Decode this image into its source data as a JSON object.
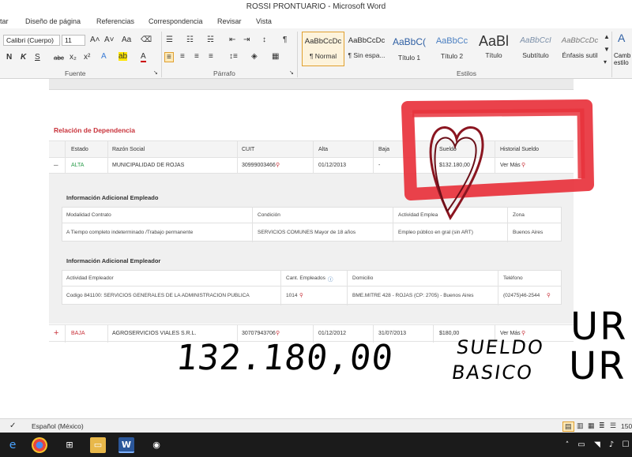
{
  "window": {
    "title": "ROSSI PRONTUARIO  -  Microsoft Word"
  },
  "ribbon_tabs": [
    "tar",
    "Diseño de página",
    "Referencias",
    "Correspondencia",
    "Revisar",
    "Vista"
  ],
  "ribbon": {
    "font_name": "Calibri (Cuerpo)",
    "font_size": "11",
    "group_font": "Fuente",
    "group_paragraph": "Párrafo",
    "group_styles": "Estilos",
    "styles": [
      {
        "sample": "AaBbCcDc",
        "name": "¶ Normal"
      },
      {
        "sample": "AaBbCcDc",
        "name": "¶ Sin espa..."
      },
      {
        "sample": "AaBbC(",
        "name": "Título 1"
      },
      {
        "sample": "AaBbCc",
        "name": "Título 2"
      },
      {
        "sample": "AaBl",
        "name": "Título"
      },
      {
        "sample": "AaBbCcI",
        "name": "Subtítulo"
      },
      {
        "sample": "AaBbCcDc",
        "name": "Énfasis sutil"
      }
    ],
    "change_styles": "Camb estilo"
  },
  "document": {
    "section_title": "Relación de Dependencia",
    "columns": [
      "Estado",
      "Razón Social",
      "CUIT",
      "Alta",
      "Baja",
      "Sueldo",
      "Historial Sueldo"
    ],
    "rows": [
      {
        "toggle": "–",
        "estado": "ALTA",
        "razon": "MUNICIPALIDAD DE ROJAS",
        "cuit": "30999003466",
        "alta": "01/12/2013",
        "baja": "-",
        "sueldo": "$132.180,00",
        "historial": "Ver Más"
      },
      {
        "toggle": "+",
        "estado": "BAJA",
        "razon": "AGROSERVICIOS VIALES S.R.L.",
        "cuit": "30707943706",
        "alta": "01/12/2012",
        "baja": "31/07/2013",
        "sueldo": "$180,00",
        "historial": "Ver Más"
      }
    ],
    "emp_info": {
      "title": "Información Adicional Empleado",
      "columns": [
        "Modalidad Contrato",
        "Condición",
        "Actividad Emplea",
        "Zona"
      ],
      "values": [
        "A Tiempo completo indeterminado /Trabajo permanente",
        "SERVICIOS COMUNES Mayor de 18 años",
        "Empleo público en gral (sin ART)",
        "Buenos Aires"
      ]
    },
    "employer_info": {
      "title": "Información Adicional Empleador",
      "columns": [
        "Actividad Empleador",
        "Cant. Empleados",
        "Domicilio",
        "Teléfono"
      ],
      "values": [
        "Codigo 841100: SERVICIOS GENERALES DE LA ADMINISTRACION PUBLICA",
        "1014",
        "BME.MITRE 428 - ROJAS (CP: 2705) - Buenos Aires",
        "(02475)46-2544"
      ]
    }
  },
  "annotation": {
    "number": "132.180,00",
    "word1": "SUELDO",
    "word2": "BASICO",
    "word3": "UR",
    "word4": "UR"
  },
  "statusbar": {
    "language": "Español (México)",
    "zoom": "150"
  },
  "colors": {
    "accent_red": "#c8323a",
    "highlight_red": "#e8323c",
    "alta_green": "#2a9c4a"
  }
}
